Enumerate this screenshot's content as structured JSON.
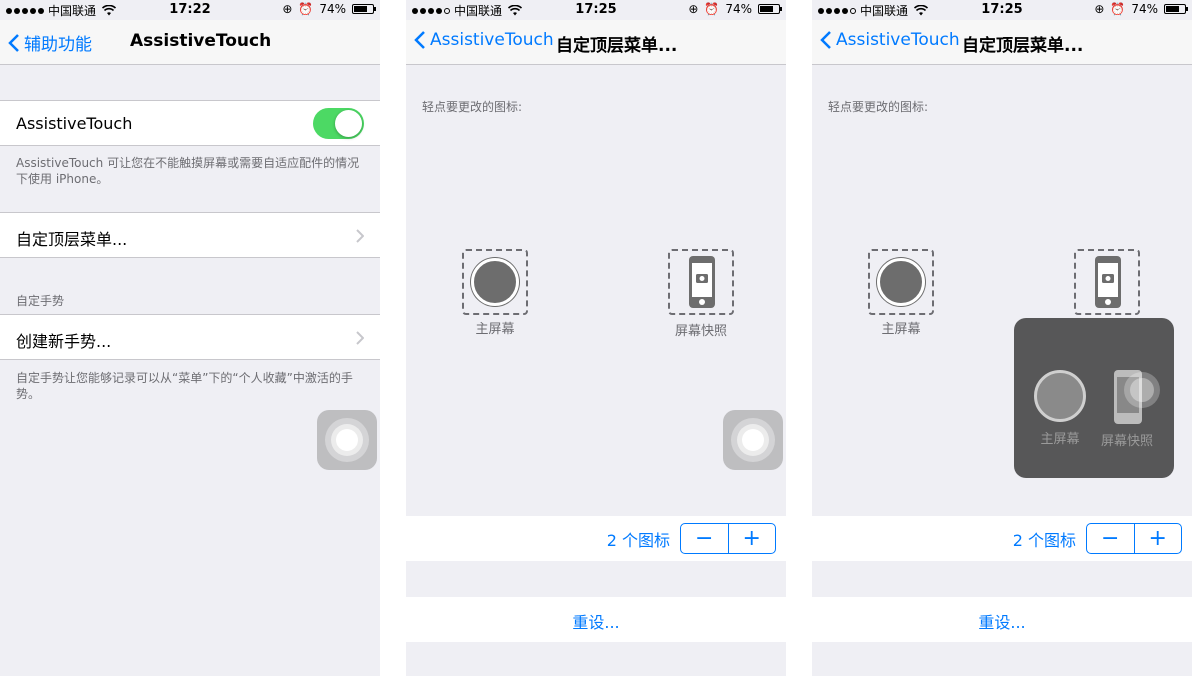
{
  "status": {
    "carrier": "中国联通",
    "battery": "74%",
    "time_1": "17:22",
    "time_2": "17:25",
    "time_3": "17:25"
  },
  "screen1": {
    "back_label": "辅助功能",
    "title": "AssistiveTouch",
    "toggle_label": "AssistiveTouch",
    "toggle_on": true,
    "toggle_footnote": "AssistiveTouch 可让您在不能触摸屏幕或需要自适应配件的情况下使用 iPhone。",
    "custom_menu": "自定顶层菜单...",
    "gestures_header": "自定手势",
    "create_gesture": "创建新手势...",
    "gestures_footnote": "自定手势让您能够记录可以从“菜单”下的“个人收藏”中激活的手势。"
  },
  "screen2": {
    "back_label": "AssistiveTouch",
    "title": "自定顶层菜单...",
    "hint": "轻点要更改的图标:",
    "icon1_label": "主屏幕",
    "icon2_label": "屏幕快照",
    "count": "2 个图标",
    "minus": "−",
    "plus": "+",
    "reset": "重设..."
  },
  "screen3": {
    "back_label": "AssistiveTouch",
    "title": "自定顶层菜单...",
    "hint": "轻点要更改的图标:",
    "icon1_label": "主屏幕",
    "popup_label1": "主屏幕",
    "popup_label2": "屏幕快照",
    "count": "2 个图标",
    "minus": "−",
    "plus": "+",
    "reset": "重设..."
  },
  "colors": {
    "accent": "#007aff",
    "toggle_on": "#4cd964",
    "background": "#efeff4"
  }
}
